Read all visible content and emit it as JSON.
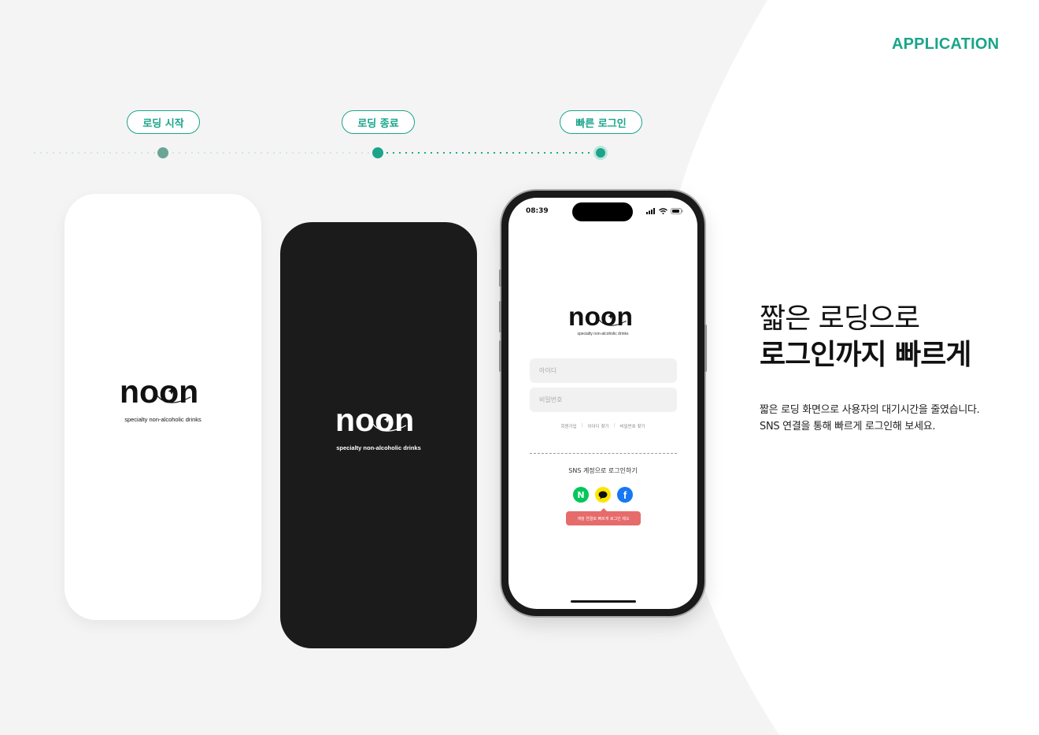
{
  "page": {
    "section_label": "APPLICATION",
    "accent_color": "#1aa58a",
    "background_color": "#f4f4f4"
  },
  "steps": [
    {
      "label": "로딩 시작"
    },
    {
      "label": "로딩 종료"
    },
    {
      "label": "빠른 로그인"
    }
  ],
  "brand": {
    "logo_text": "noon",
    "tagline": "specialty non-alcoholic drinks"
  },
  "login_screen": {
    "time": "08:39",
    "id_placeholder": "아이디",
    "password_placeholder": "비밀번호",
    "links": [
      "회원가입",
      "아이디 찾기",
      "비밀번호 찾기"
    ],
    "sns_label": "SNS 계정으로 로그인하기",
    "sns_buttons": [
      {
        "name": "naver",
        "glyph": "N",
        "color": "#03c75a"
      },
      {
        "name": "kakao",
        "glyph": "speech-bubble-icon",
        "color": "#fee500"
      },
      {
        "name": "facebook",
        "glyph": "f",
        "color": "#1877f2"
      }
    ],
    "tooltip": "계정 연결로 빠르게 로그인 제오"
  },
  "headline": {
    "line1": "짧은 로딩으로",
    "line2": "로그인까지 빠르게"
  },
  "description": {
    "line1": "짧은 로딩 화면으로 사용자의 대기시간을 줄였습니다.",
    "line2": "SNS 연결을 통해 빠르게 로그인해 보세요."
  }
}
